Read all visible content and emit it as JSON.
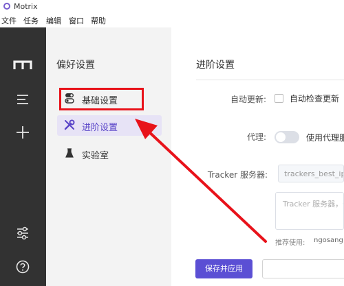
{
  "window": {
    "title": "Motrix"
  },
  "menubar": {
    "items": [
      "文件",
      "任务",
      "编辑",
      "窗口",
      "帮助"
    ]
  },
  "rail": {
    "icons": [
      "motrix-logo-icon",
      "task-list-icon",
      "add-icon",
      "settings-sliders-icon",
      "help-icon"
    ]
  },
  "preferences": {
    "title": "偏好设置",
    "items": [
      {
        "label": "基础设置",
        "icon": "toggle-icon"
      },
      {
        "label": "进阶设置",
        "icon": "wrench-icon",
        "active": true
      },
      {
        "label": "实验室",
        "icon": "flask-icon"
      }
    ]
  },
  "main": {
    "title": "进阶设置",
    "auto_update": {
      "label": "自动更新:",
      "checkbox_label": "自动检查更新"
    },
    "proxy": {
      "label": "代理:",
      "toggle_label": "使用代理服"
    },
    "tracker": {
      "label": "Tracker 服务器:",
      "select_value": "trackers_best_ip.tx",
      "textarea_placeholder": "Tracker 服务器，一",
      "recommend_label": "推荐使用:",
      "recommend_value": "ngosang"
    },
    "save_button": "保存并应用"
  },
  "colors": {
    "accent": "#5b4fd4",
    "annotation": "#e8121a",
    "rail": "#323232"
  }
}
